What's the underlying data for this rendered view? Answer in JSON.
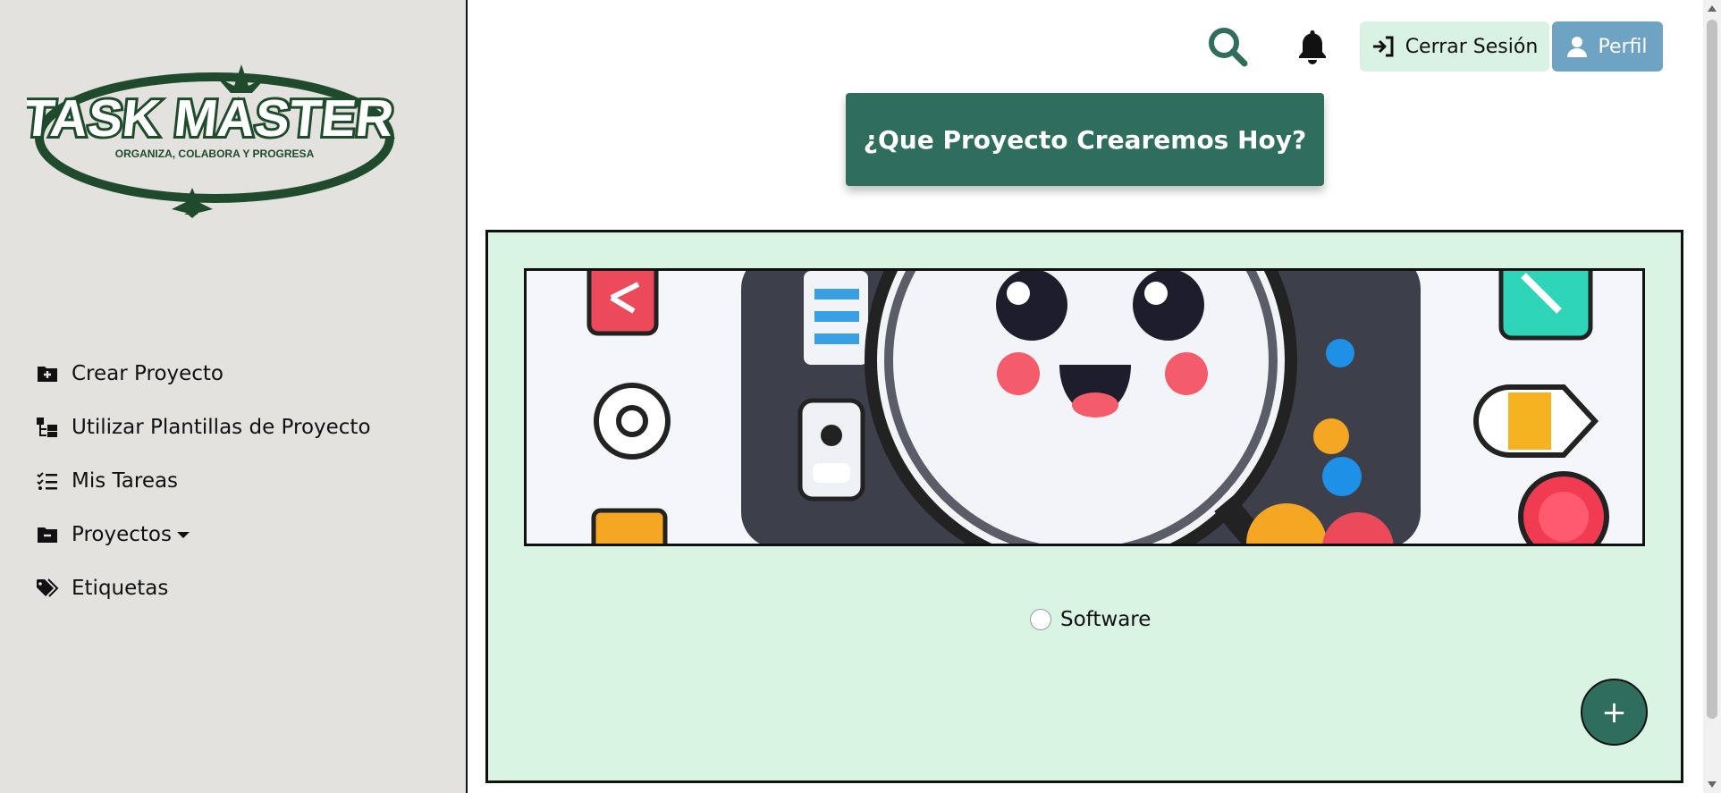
{
  "logo": {
    "title": "TASK MASTER",
    "tagline": "ORGANIZA, COLABORA Y PROGRESA"
  },
  "sidebar": {
    "items": [
      {
        "label": "Crear Proyecto",
        "icon": "folder-plus-icon"
      },
      {
        "label": "Utilizar Plantillas de Proyecto",
        "icon": "folder-tree-icon"
      },
      {
        "label": "Mis Tareas",
        "icon": "list-check-icon"
      },
      {
        "label": "Proyectos",
        "icon": "folder-minus-icon",
        "dropdown": true
      },
      {
        "label": "Etiquetas",
        "icon": "tags-icon"
      }
    ]
  },
  "header": {
    "search_icon": "search-icon",
    "bell_icon": "bell-icon",
    "logout_label": "Cerrar Sesión",
    "profile_label": "Perfil"
  },
  "main": {
    "banner_title": "¿Que Proyecto Crearemos Hoy?",
    "template_option": "Software",
    "add_label": "+"
  },
  "colors": {
    "sidebar_bg": "#e3e2de",
    "brand_green": "#2f6e5c",
    "panel_bg": "#daf4e4",
    "logout_bg": "#d9f2e3",
    "profile_bg": "#6fa3c3",
    "logo_green": "#1f4a2c"
  }
}
